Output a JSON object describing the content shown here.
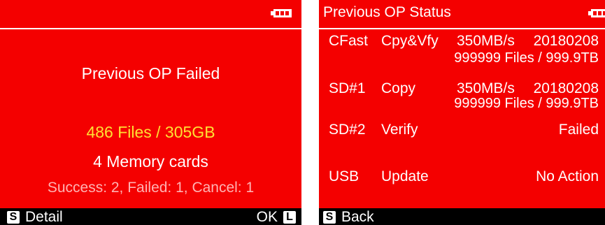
{
  "colors": {
    "background": "#f40000",
    "text": "#ffffff",
    "highlight": "#ffe033",
    "secondary": "#ffb3b3",
    "bar": "#000000"
  },
  "left": {
    "battery_icon": "battery-full-icon",
    "heading": "Previous OP Failed",
    "summary": "486 Files / 305GB",
    "cards": "4 Memory cards",
    "results": "Success: 2, Failed: 1, Cancel: 1",
    "left_key": "S",
    "left_action": "Detail",
    "right_action": "OK",
    "right_key": "L"
  },
  "right": {
    "title": "Previous OP Status",
    "battery_icon": "battery-full-icon",
    "rows": [
      {
        "device": "CFast",
        "op": "Cpy&Vfy",
        "speed": "350MB/s",
        "date": "20180208",
        "detail": "999999 Files / 999.9TB"
      },
      {
        "device": "SD#1",
        "op": "Copy",
        "speed": "350MB/s",
        "date": "20180208",
        "detail": "999999 Files / 999.9TB"
      },
      {
        "device": "SD#2",
        "op": "Verify",
        "status": "Failed"
      },
      {
        "device": "USB",
        "op": "Update",
        "status": "No Action"
      }
    ],
    "back_key": "S",
    "back_label": "Back"
  }
}
